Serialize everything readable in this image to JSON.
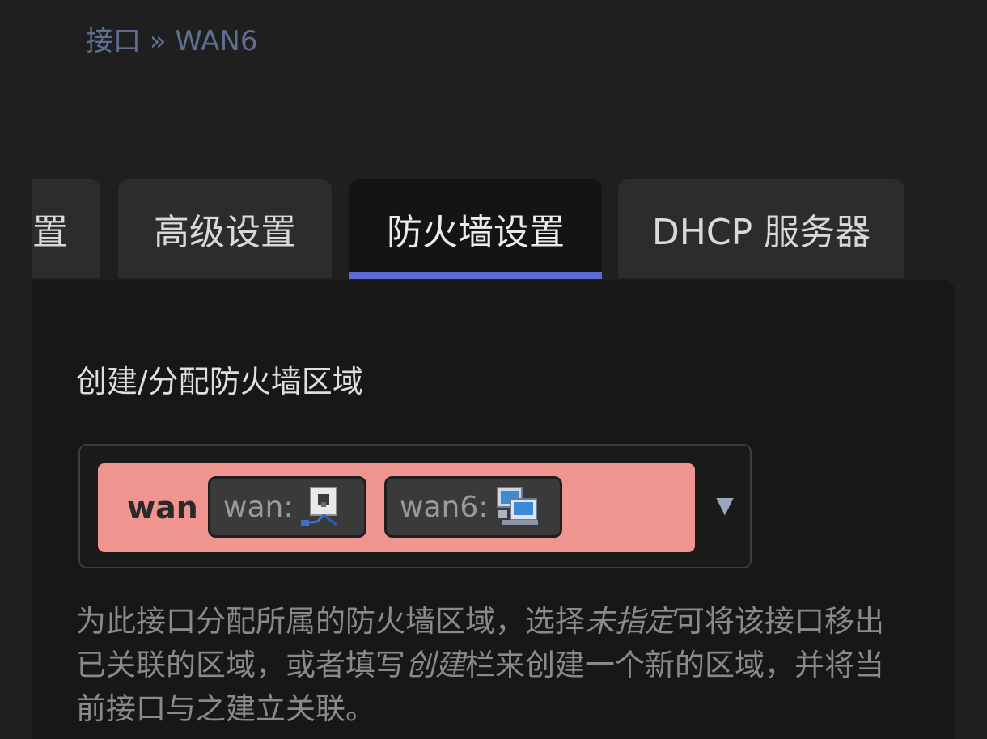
{
  "breadcrumb": {
    "text": "接口 » WAN6"
  },
  "tabs": [
    {
      "label": "置"
    },
    {
      "label": "高级设置"
    },
    {
      "label": "防火墙设置"
    },
    {
      "label": "DHCP 服务器"
    }
  ],
  "active_tab": "防火墙设置",
  "colors": {
    "accent": "#5b6bd6",
    "zone_wan": "#f09490",
    "background": "#1f1f1f",
    "panel": "#171717"
  },
  "firewall": {
    "label": "创建/分配防火墙区域",
    "zone_name": "wan",
    "interfaces": [
      {
        "label": "wan:",
        "icon": "ethernet-port-icon"
      },
      {
        "label": "wan6:",
        "icon": "network-computers-icon"
      }
    ],
    "help": {
      "part1": "为此接口分配所属的防火墙区域，选择",
      "em1": "未指定",
      "part2": "可将该接口移出已关联的区域，或者填写",
      "em2": "创建",
      "part3": "栏来创建一个新的区域，并将当前接口与之建立关联。"
    }
  }
}
